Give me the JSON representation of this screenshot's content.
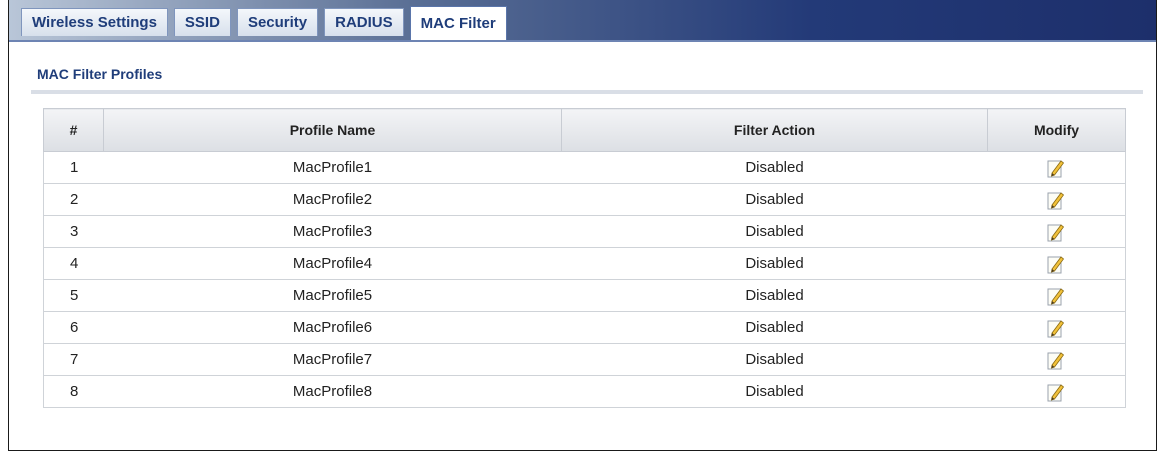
{
  "tabs": [
    {
      "label": "Wireless Settings",
      "active": false
    },
    {
      "label": "SSID",
      "active": false
    },
    {
      "label": "Security",
      "active": false
    },
    {
      "label": "RADIUS",
      "active": false
    },
    {
      "label": "MAC Filter",
      "active": true
    }
  ],
  "section": {
    "title": "MAC Filter Profiles"
  },
  "table": {
    "headers": [
      "#",
      "Profile Name",
      "Filter Action",
      "Modify"
    ],
    "modify_icon": "edit-icon",
    "rows": [
      {
        "num": "1",
        "name": "MacProfile1",
        "action": "Disabled"
      },
      {
        "num": "2",
        "name": "MacProfile2",
        "action": "Disabled"
      },
      {
        "num": "3",
        "name": "MacProfile3",
        "action": "Disabled"
      },
      {
        "num": "4",
        "name": "MacProfile4",
        "action": "Disabled"
      },
      {
        "num": "5",
        "name": "MacProfile5",
        "action": "Disabled"
      },
      {
        "num": "6",
        "name": "MacProfile6",
        "action": "Disabled"
      },
      {
        "num": "7",
        "name": "MacProfile7",
        "action": "Disabled"
      },
      {
        "num": "8",
        "name": "MacProfile8",
        "action": "Disabled"
      }
    ]
  },
  "colors": {
    "accent": "#1f3d7a",
    "tabbar_dark": "#1d2f6b",
    "header_bg": "#dcdfe4"
  }
}
